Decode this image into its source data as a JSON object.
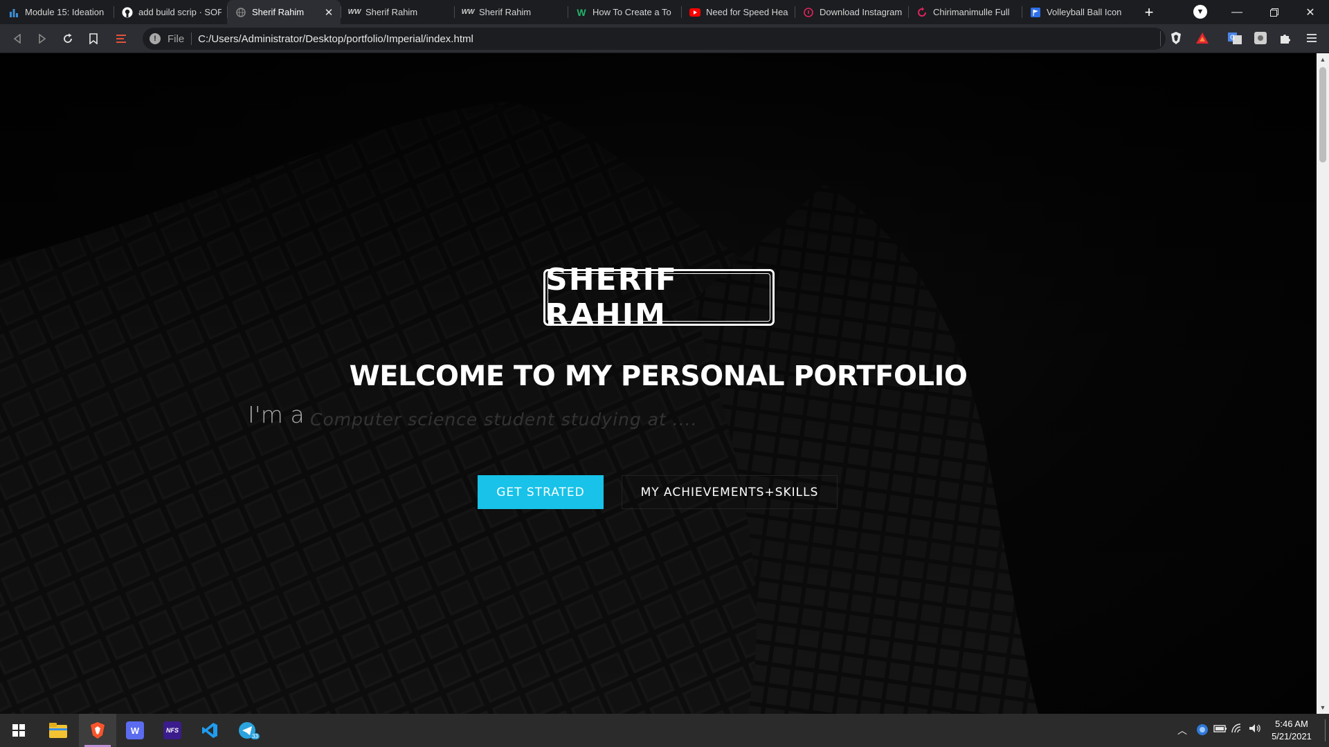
{
  "browser": {
    "tabs": [
      {
        "title": "Module 15: Ideation",
        "icon": "chart-bars-icon",
        "color": "#3b8fd6"
      },
      {
        "title": "add build scrip · SOF",
        "icon": "github-icon",
        "color": "#ffffff"
      },
      {
        "title": "Sherif Rahim",
        "icon": "globe-icon",
        "color": "#8a8a8a",
        "active": true
      },
      {
        "title": "Sherif Rahim",
        "icon": "signature-logo-icon",
        "color": "#cfcfcf"
      },
      {
        "title": "Sherif Rahim",
        "icon": "signature-logo-icon",
        "color": "#cfcfcf"
      },
      {
        "title": "How To Create a To",
        "icon": "w-logo-icon",
        "color": "#21b36b"
      },
      {
        "title": "Need for Speed Hea",
        "icon": "youtube-icon",
        "color": "#ff0000"
      },
      {
        "title": "Download Instagram",
        "icon": "download-icon",
        "color": "#e0245e"
      },
      {
        "title": "Chirimanimulle Full",
        "icon": "refresh-circle-icon",
        "color": "#e0245e"
      },
      {
        "title": "Volleyball Ball Icon",
        "icon": "flag-icon",
        "color": "#2f6fe6"
      }
    ],
    "tab_close_glyph": "✕",
    "new_tab_glyph": "+",
    "address": {
      "scheme_label": "File",
      "url": "C:/Users/Administrator/Desktop/portfolio/Imperial/index.html"
    }
  },
  "page": {
    "logo_text": "SHERIF RAHIM",
    "headline": "WELCOME TO MY PERSONAL PORTFOLIO",
    "typed_prefix": "I'm a",
    "typed_text": "Computer science student studying at ....",
    "primary_button": "GET STRATED",
    "secondary_button": "MY ACHIEVEMENTS+SKILLS"
  },
  "taskbar": {
    "time": "5:46 AM",
    "date": "5/21/2021",
    "telegram_badge": "33"
  },
  "colors": {
    "accent": "#18c2e8",
    "tab_strip": "#1c1d20",
    "toolbar": "#2d2e33",
    "taskbar": "#2b2b2b"
  }
}
